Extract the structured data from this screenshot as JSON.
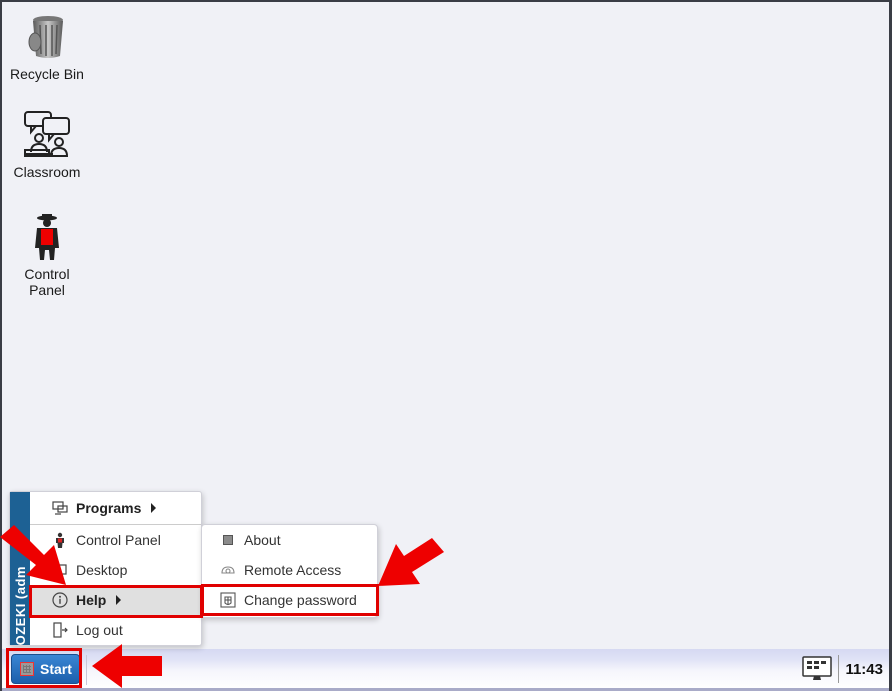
{
  "desktop": {
    "icons": [
      {
        "label": "Recycle Bin",
        "icon": "recycle-bin-icon"
      },
      {
        "label": "Classroom",
        "icon": "classroom-icon"
      },
      {
        "label": "Control\nPanel",
        "label_line1": "Control",
        "label_line2": "Panel",
        "icon": "control-panel-icon"
      }
    ]
  },
  "start_menu": {
    "sidebar_label": "OZEKI (adm",
    "items": [
      {
        "label": "Programs",
        "icon": "programs-icon",
        "has_submenu": true
      },
      {
        "label": "Control Panel",
        "icon": "control-panel-icon"
      },
      {
        "label": "Desktop",
        "icon": "desktop-icon"
      },
      {
        "label": "Help",
        "icon": "info-icon",
        "has_submenu": true,
        "active": true
      },
      {
        "label": "Log out",
        "icon": "logout-icon"
      }
    ]
  },
  "help_submenu": {
    "items": [
      {
        "label": "About",
        "icon": "about-icon"
      },
      {
        "label": "Remote Access",
        "icon": "remote-access-icon"
      },
      {
        "label": "Change password",
        "icon": "change-password-icon",
        "highlighted": true
      }
    ]
  },
  "taskbar": {
    "start_label": "Start",
    "clock": "11:43"
  },
  "colors": {
    "accent": "#1d6194",
    "start_button": "#2a73c2",
    "highlight": "#e00000",
    "desktop_bg": "#f0f1f6"
  }
}
